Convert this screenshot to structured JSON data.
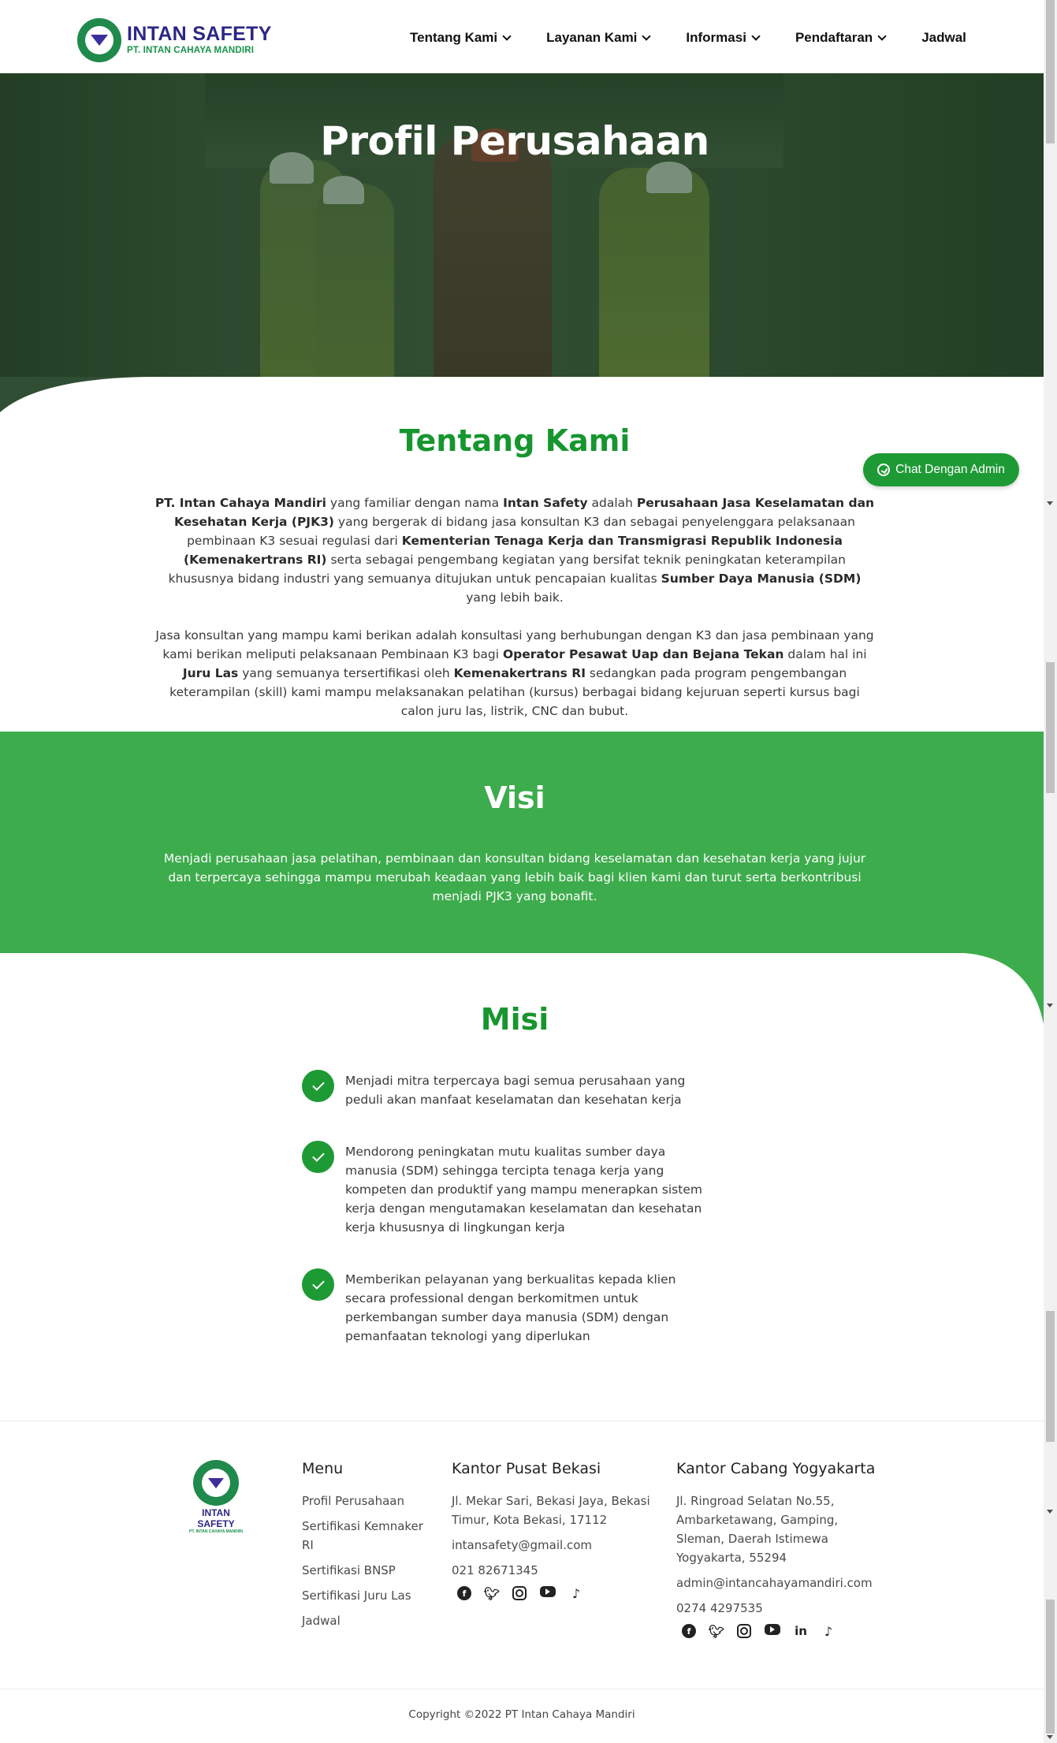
{
  "header": {
    "logo_title": "INTAN SAFETY",
    "logo_subtitle": "PT. INTAN CAHAYA MANDIRI",
    "nav": [
      {
        "label": "Tentang Kami",
        "has_dropdown": true
      },
      {
        "label": "Layanan Kami",
        "has_dropdown": true
      },
      {
        "label": "Informasi",
        "has_dropdown": true
      },
      {
        "label": "Pendaftaran",
        "has_dropdown": true
      },
      {
        "label": "Jadwal",
        "has_dropdown": false
      }
    ]
  },
  "hero": {
    "title": "Profil Perusahaan"
  },
  "chat_button": {
    "label": "Chat Dengan Admin",
    "icon": "whatsapp-icon"
  },
  "about": {
    "title": "Tentang Kami",
    "p1": [
      {
        "b": true,
        "t": "PT. Intan Cahaya Mandiri"
      },
      {
        "b": false,
        "t": " yang familiar dengan nama "
      },
      {
        "b": true,
        "t": "Intan Safety"
      },
      {
        "b": false,
        "t": " adalah "
      },
      {
        "b": true,
        "t": "Perusahaan Jasa Keselamatan dan Kesehatan Kerja (PJK3)"
      },
      {
        "b": false,
        "t": " yang bergerak di bidang jasa konsultan K3 dan sebagai penyelenggara pelaksanaan pembinaan K3 sesuai regulasi dari "
      },
      {
        "b": true,
        "t": "Kementerian Tenaga Kerja dan Transmigrasi Republik Indonesia (Kemenakertrans RI)"
      },
      {
        "b": false,
        "t": " serta sebagai pengembang kegiatan yang bersifat teknik peningkatan keterampilan khususnya bidang industri yang semuanya ditujukan untuk pencapaian kualitas "
      },
      {
        "b": true,
        "t": "Sumber Daya Manusia (SDM)"
      },
      {
        "b": false,
        "t": " yang lebih baik."
      }
    ],
    "p2": [
      {
        "b": false,
        "t": "Jasa konsultan yang mampu kami berikan adalah konsultasi yang berhubungan dengan K3 dan jasa pembinaan yang kami berikan meliputi pelaksanaan Pembinaan K3 bagi "
      },
      {
        "b": true,
        "t": "Operator Pesawat Uap dan Bejana Tekan"
      },
      {
        "b": false,
        "t": " dalam hal ini "
      },
      {
        "b": true,
        "t": "Juru Las"
      },
      {
        "b": false,
        "t": " yang semuanya tersertifikasi oleh "
      },
      {
        "b": true,
        "t": "Kemenakertrans RI"
      },
      {
        "b": false,
        "t": " sedangkan pada program pengembangan keterampilan (skill) kami mampu melaksanakan pelatihan (kursus) berbagai bidang kejuruan seperti kursus bagi calon juru las, listrik, CNC dan bubut."
      }
    ]
  },
  "visi": {
    "title": "Visi",
    "text": "Menjadi perusahaan jasa pelatihan, pembinaan dan konsultan bidang keselamatan dan kesehatan kerja yang jujur dan terpercaya sehingga mampu merubah keadaan yang lebih baik bagi klien kami dan turut serta berkontribusi menjadi PJK3 yang bonafit."
  },
  "misi": {
    "title": "Misi",
    "items": [
      "Menjadi mitra terpercaya bagi semua perusahaan yang peduli akan manfaat keselamatan dan kesehatan kerja",
      "Mendorong peningkatan mutu kualitas sumber daya manusia (SDM) sehingga tercipta tenaga kerja yang kompeten dan produktif yang mampu menerapkan sistem kerja dengan mengutamakan keselamatan dan kesehatan kerja khususnya di lingkungan kerja",
      "Memberikan pelayanan yang berkualitas kepada klien secara professional dengan berkomitmen untuk perkembangan sumber daya manusia (SDM) dengan pemanfaatan teknologi yang diperlukan"
    ]
  },
  "footer": {
    "logo_title": "INTAN SAFETY",
    "logo_subtitle": "PT. INTAN CAHAYA MANDIRI",
    "menu": {
      "title": "Menu",
      "items": [
        "Profil Perusahaan",
        "Sertifikasi Kemnaker RI",
        "Sertifikasi BNSP",
        "Sertifikasi Juru Las",
        "Jadwal"
      ]
    },
    "bekasi": {
      "title": "Kantor Pusat Bekasi",
      "address": "Jl. Mekar Sari, Bekasi Jaya, Bekasi Timur, Kota Bekasi, 17112",
      "email": "intansafety@gmail.com",
      "phone": "021 82671345",
      "socials": [
        "facebook-icon",
        "twitter-icon",
        "instagram-icon",
        "youtube-icon",
        "tiktok-icon"
      ]
    },
    "yogya": {
      "title": "Kantor Cabang Yogyakarta",
      "address": "Jl. Ringroad Selatan No.55, Ambarketawang, Gamping, Sleman, Daerah Istimewa Yogyakarta, 55294",
      "email": "admin@intancahayamandiri.com",
      "phone": "0274 4297535",
      "socials": [
        "facebook-icon",
        "twitter-icon",
        "instagram-icon",
        "youtube-icon",
        "linkedin-icon",
        "tiktok-icon"
      ]
    },
    "copyright": "Copyright ©2022 PT Intan Cahaya Mandiri"
  },
  "colors": {
    "brand_green": "#17962f",
    "visi_bg": "#3dac4c",
    "brand_navy": "#2b2787"
  }
}
